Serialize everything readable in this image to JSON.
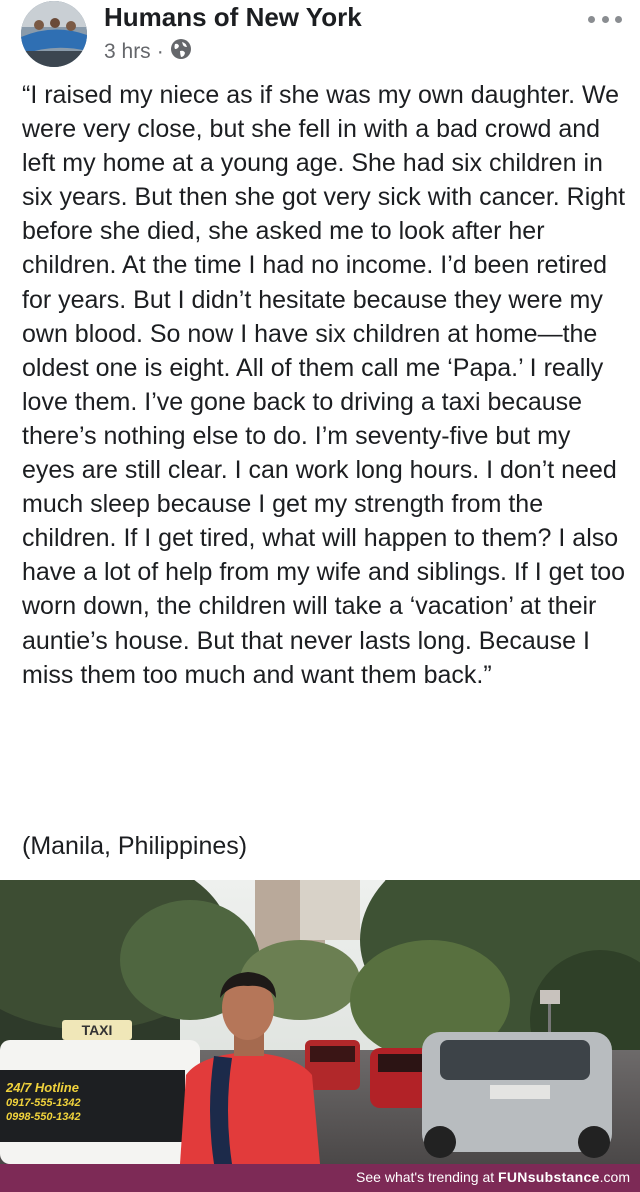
{
  "post": {
    "page_name": "Humans of New York",
    "time": "3 hrs",
    "separator": "·",
    "privacy_icon": "globe-icon",
    "more_icon": "more-dots-icon",
    "text": "“I raised my niece as if she was my own daughter.  We were very close, but she fell in with a bad crowd and left my home at a young age.  She had six children in six years.  But then she got very sick with cancer.  Right before she died, she asked me to look after her children.  At the time I had no income.  I’d been retired for years.  But I didn’t hesitate because they were my own blood.  So now I have six children at home—the oldest one is eight.  All of them call me ‘Papa.’ I really love them.  I’ve gone back to driving a taxi because there’s nothing else to do.  I’m seventy-five but my eyes are still clear.  I can work long hours.  I don’t need much sleep because I get my strength from the children.  If I get tired, what will happen to them?  I also have a lot of help from my wife and siblings.  If I get too worn down, the children will take a ‘vacation’ at their auntie’s house.  But that never lasts long.  Because I miss them too much and want them back.”",
    "location": "(Manila, Philippines)"
  },
  "photo": {
    "taxi_sign": "TAXI",
    "hotline_text": "24/7 Hotline",
    "phone_1": "0917-555-1342",
    "phone_2": "0998-550-1342",
    "license_plate": ""
  },
  "footer": {
    "prefix": "See what's trending at ",
    "brand_bold": "FUNSUBSTANCE",
    "brand_suffix": ".com",
    "brand_display": "FUNsubstance"
  },
  "colors": {
    "text": "#1c1e21",
    "meta": "#65676b",
    "footer_bg": "#7d2a56",
    "shirt": "#e23b3b"
  }
}
